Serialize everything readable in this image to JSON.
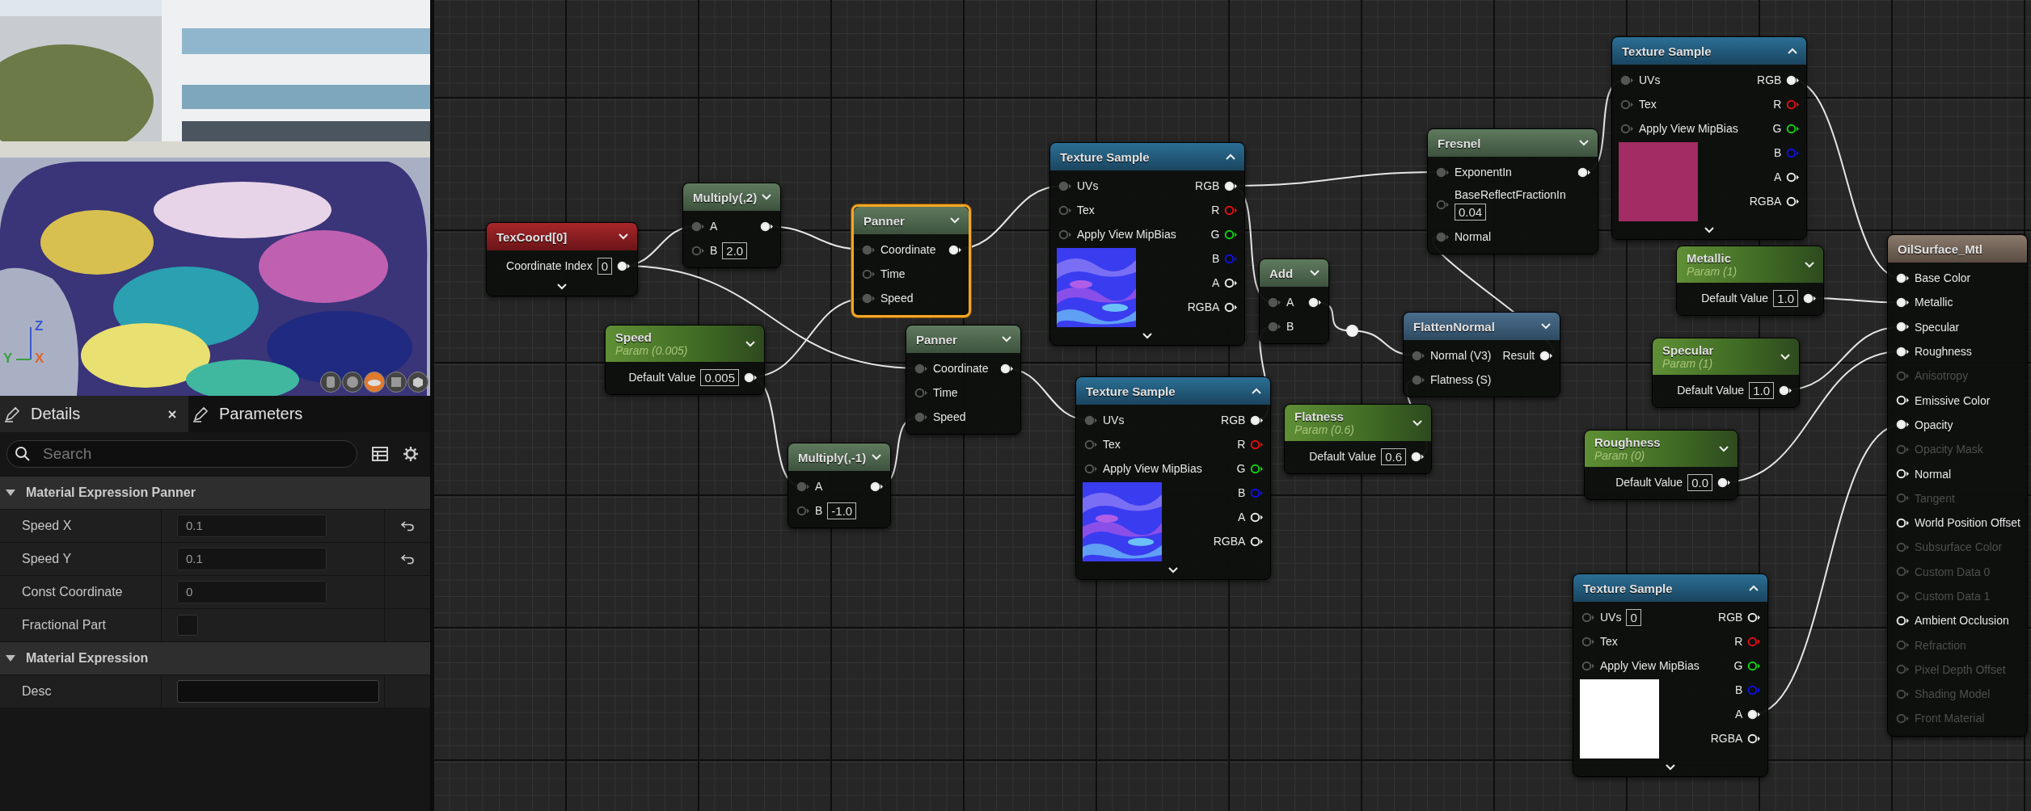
{
  "viewport": {
    "axes": [
      {
        "label": "Z",
        "color": "#3a5bd0"
      },
      {
        "label": "Y",
        "color": "#3aa040"
      },
      {
        "label": "X",
        "color": "#e0652e"
      }
    ],
    "preview_shapes": [
      {
        "kind": "cylinder",
        "selected": false
      },
      {
        "kind": "sphere",
        "selected": false
      },
      {
        "kind": "plane",
        "selected": true
      },
      {
        "kind": "cube",
        "selected": false
      },
      {
        "kind": "mesh",
        "selected": false
      }
    ]
  },
  "details": {
    "tabs": [
      {
        "label": "Details",
        "selected": true,
        "closable": true
      },
      {
        "label": "Parameters",
        "selected": false,
        "closable": false
      }
    ],
    "search": {
      "placeholder": "Search"
    },
    "sections": [
      {
        "title": "Material Expression Panner",
        "expanded": true,
        "rows": [
          {
            "label": "Speed X",
            "kind": "number",
            "value": "0.1",
            "resettable": true
          },
          {
            "label": "Speed Y",
            "kind": "number",
            "value": "0.1",
            "resettable": true
          },
          {
            "label": "Const Coordinate",
            "kind": "number",
            "value": "0",
            "resettable": false
          },
          {
            "label": "Fractional Part",
            "kind": "checkbox",
            "checked": false,
            "resettable": false
          }
        ]
      },
      {
        "title": "Material Expression",
        "expanded": true,
        "rows": [
          {
            "label": "Desc",
            "kind": "text",
            "resettable": false
          }
        ]
      }
    ]
  },
  "graph": {
    "nodes": [
      {
        "kind": "texcoord",
        "title": "TexCoord[0]",
        "selected": false,
        "outputs": [
          {
            "label": "Coordinate Index",
            "value": "0",
            "connected": true
          }
        ]
      },
      {
        "kind": "math",
        "title": "Multiply(,2)",
        "selected": false,
        "inputs": [
          {
            "label": "A",
            "connected": true
          },
          {
            "label": "B",
            "value": "2.0",
            "connected": false
          }
        ],
        "outputs": [
          {
            "connected": true
          }
        ]
      },
      {
        "kind": "panner",
        "title": "Panner",
        "selected": true,
        "inputs": [
          {
            "label": "Coordinate",
            "connected": true
          },
          {
            "label": "Time",
            "connected": false
          },
          {
            "label": "Speed",
            "connected": true
          }
        ],
        "outputs": [
          {
            "connected": true
          }
        ]
      },
      {
        "kind": "param",
        "title": "Speed",
        "subtitle": "Param (0.005)",
        "selected": false,
        "outputs": [
          {
            "label": "Default Value",
            "value": "0.005",
            "connected": true
          }
        ]
      },
      {
        "kind": "panner",
        "title": "Panner",
        "selected": false,
        "inputs": [
          {
            "label": "Coordinate",
            "connected": true
          },
          {
            "label": "Time",
            "connected": false
          },
          {
            "label": "Speed",
            "connected": true
          }
        ],
        "outputs": [
          {
            "connected": true
          }
        ]
      },
      {
        "kind": "math",
        "title": "Multiply(,-1)",
        "selected": false,
        "inputs": [
          {
            "label": "A",
            "connected": true
          },
          {
            "label": "B",
            "value": "-1.0",
            "connected": false
          }
        ],
        "outputs": [
          {
            "connected": true
          }
        ]
      },
      {
        "kind": "texture",
        "title": "Texture Sample",
        "selected": false,
        "preview": {
          "kind": "normal-map"
        },
        "inputs": [
          {
            "label": "UVs",
            "connected": true
          },
          {
            "label": "Tex",
            "connected": false
          },
          {
            "label": "Apply View MipBias",
            "connected": false
          }
        ],
        "outputs": [
          {
            "label": "RGB",
            "connected": true
          },
          {
            "label": "R",
            "connected": false,
            "color": "#e01010"
          },
          {
            "label": "G",
            "connected": false,
            "color": "#10d010"
          },
          {
            "label": "B",
            "connected": false,
            "color": "#1010e0"
          },
          {
            "label": "A",
            "connected": false
          },
          {
            "label": "RGBA",
            "connected": false
          }
        ]
      },
      {
        "kind": "texture",
        "title": "Texture Sample",
        "selected": false,
        "preview": {
          "kind": "normal-map"
        },
        "inputs": [
          {
            "label": "UVs",
            "connected": true
          },
          {
            "label": "Tex",
            "connected": false
          },
          {
            "label": "Apply View MipBias",
            "connected": false
          }
        ],
        "outputs": [
          {
            "label": "RGB",
            "connected": true
          },
          {
            "label": "R",
            "connected": false,
            "color": "#e01010"
          },
          {
            "label": "G",
            "connected": false,
            "color": "#10d010"
          },
          {
            "label": "B",
            "connected": false,
            "color": "#1010e0"
          },
          {
            "label": "A",
            "connected": false
          },
          {
            "label": "RGBA",
            "connected": false
          }
        ]
      },
      {
        "kind": "math",
        "title": "Add",
        "selected": false,
        "inputs": [
          {
            "label": "A",
            "connected": true
          },
          {
            "label": "B",
            "connected": true
          }
        ],
        "outputs": [
          {
            "connected": true
          }
        ]
      },
      {
        "kind": "fresnel",
        "title": "Fresnel",
        "selected": false,
        "inputs": [
          {
            "label": "ExponentIn",
            "connected": true
          },
          {
            "label": "BaseReflectFractionIn",
            "value": "0.04",
            "connected": false
          },
          {
            "label": "Normal",
            "connected": true
          }
        ],
        "outputs": [
          {
            "connected": true
          }
        ]
      },
      {
        "kind": "function",
        "title": "FlattenNormal",
        "selected": false,
        "inputs": [
          {
            "label": "Normal (V3)",
            "connected": true
          },
          {
            "label": "Flatness (S)",
            "connected": true
          }
        ],
        "outputs": [
          {
            "label": "Result",
            "connected": true
          }
        ]
      },
      {
        "kind": "param",
        "title": "Flatness",
        "subtitle": "Param (0.6)",
        "selected": false,
        "outputs": [
          {
            "label": "Default Value",
            "value": "0.6",
            "connected": true
          }
        ]
      },
      {
        "kind": "texture",
        "title": "Texture Sample",
        "selected": false,
        "preview": {
          "kind": "solid",
          "color": "#a22c63"
        },
        "inputs": [
          {
            "label": "UVs",
            "connected": true
          },
          {
            "label": "Tex",
            "connected": false
          },
          {
            "label": "Apply View MipBias",
            "connected": false
          }
        ],
        "outputs": [
          {
            "label": "RGB",
            "connected": true
          },
          {
            "label": "R",
            "connected": false,
            "color": "#e01010"
          },
          {
            "label": "G",
            "connected": false,
            "color": "#10d010"
          },
          {
            "label": "B",
            "connected": false,
            "color": "#1010e0"
          },
          {
            "label": "A",
            "connected": false
          },
          {
            "label": "RGBA",
            "connected": false
          }
        ]
      },
      {
        "kind": "param",
        "title": "Metallic",
        "subtitle": "Param (1)",
        "selected": false,
        "outputs": [
          {
            "label": "Default Value",
            "value": "1.0",
            "connected": true
          }
        ]
      },
      {
        "kind": "param",
        "title": "Specular",
        "subtitle": "Param (1)",
        "selected": false,
        "outputs": [
          {
            "label": "Default Value",
            "value": "1.0",
            "connected": true
          }
        ]
      },
      {
        "kind": "param",
        "title": "Roughness",
        "subtitle": "Param (0)",
        "selected": false,
        "outputs": [
          {
            "label": "Default Value",
            "value": "0.0",
            "connected": true
          }
        ]
      },
      {
        "kind": "texture",
        "title": "Texture Sample",
        "selected": false,
        "preview": {
          "kind": "solid",
          "color": "#ffffff"
        },
        "inputs": [
          {
            "label": "UVs",
            "value": "0",
            "connected": false
          },
          {
            "label": "Tex",
            "connected": false
          },
          {
            "label": "Apply View MipBias",
            "connected": false
          }
        ],
        "outputs": [
          {
            "label": "RGB",
            "connected": false
          },
          {
            "label": "R",
            "connected": false,
            "color": "#e01010"
          },
          {
            "label": "G",
            "connected": false,
            "color": "#10d010"
          },
          {
            "label": "B",
            "connected": false,
            "color": "#1010e0"
          },
          {
            "label": "A",
            "connected": true
          },
          {
            "label": "RGBA",
            "connected": false
          }
        ]
      },
      {
        "kind": "result",
        "title": "OilSurface_Mtl",
        "selected": false,
        "inputs": [
          {
            "label": "Base Color",
            "connected": true,
            "enabled": true
          },
          {
            "label": "Metallic",
            "connected": true,
            "enabled": true
          },
          {
            "label": "Specular",
            "connected": true,
            "enabled": true
          },
          {
            "label": "Roughness",
            "connected": true,
            "enabled": true
          },
          {
            "label": "Anisotropy",
            "connected": false,
            "enabled": false
          },
          {
            "label": "Emissive Color",
            "connected": false,
            "enabled": true
          },
          {
            "label": "Opacity",
            "connected": true,
            "enabled": true
          },
          {
            "label": "Opacity Mask",
            "connected": false,
            "enabled": false
          },
          {
            "label": "Normal",
            "connected": false,
            "enabled": true
          },
          {
            "label": "Tangent",
            "connected": false,
            "enabled": false
          },
          {
            "label": "World Position Offset",
            "connected": false,
            "enabled": true
          },
          {
            "label": "Subsurface Color",
            "connected": false,
            "enabled": false
          },
          {
            "label": "Custom Data 0",
            "connected": false,
            "enabled": false
          },
          {
            "label": "Custom Data 1",
            "connected": false,
            "enabled": false
          },
          {
            "label": "Ambient Occlusion",
            "connected": false,
            "enabled": true
          },
          {
            "label": "Refraction",
            "connected": false,
            "enabled": false
          },
          {
            "label": "Pixel Depth Offset",
            "connected": false,
            "enabled": false
          },
          {
            "label": "Shading Model",
            "connected": false,
            "enabled": false
          },
          {
            "label": "Front Material",
            "connected": false,
            "enabled": false
          }
        ]
      }
    ]
  }
}
